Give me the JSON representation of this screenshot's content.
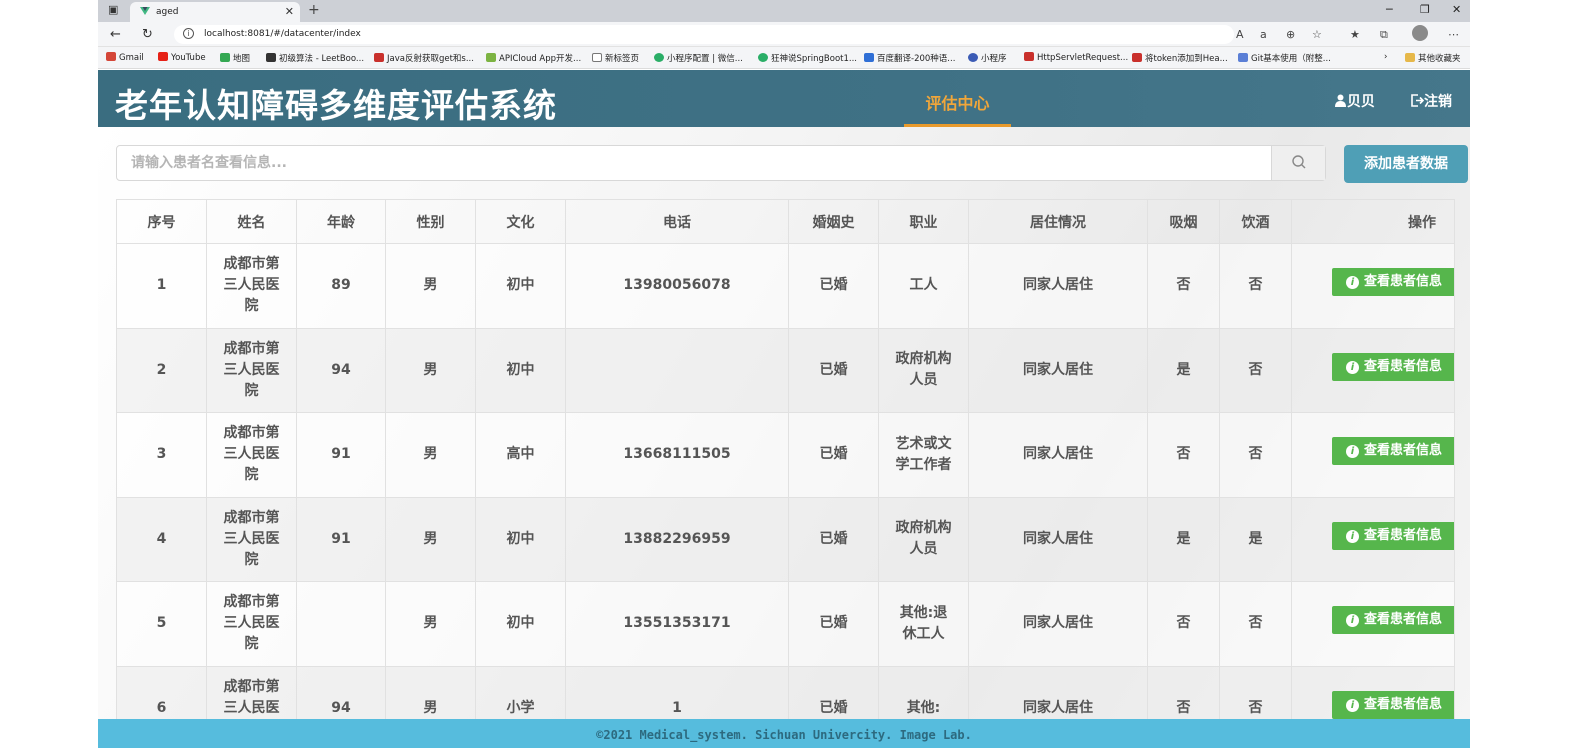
{
  "browser": {
    "tab_title": "aged",
    "url": "localhost:8081/#/datacenter/index",
    "bookmarks": [
      {
        "label": "Gmail",
        "color": "#d44638"
      },
      {
        "label": "YouTube",
        "color": "#e62117"
      },
      {
        "label": "地图",
        "color": "#34a853"
      },
      {
        "label": "初级算法 - LeetBoo...",
        "color": "#333333"
      },
      {
        "label": "Java反射获取get和s...",
        "color": "#c9302c"
      },
      {
        "label": "APICloud App开发...",
        "color": "#7cb342"
      },
      {
        "label": "新标签页",
        "color": "#777777"
      },
      {
        "label": "小程序配置 | 微信...",
        "color": "#2aae67"
      },
      {
        "label": "狂神说SpringBoot1...",
        "color": "#2aae67"
      },
      {
        "label": "百度翻译-200种语...",
        "color": "#2f6fd6"
      },
      {
        "label": "小程序",
        "color": "#3b5bb5"
      },
      {
        "label": "HttpServletRequest...",
        "color": "#c9302c"
      },
      {
        "label": "将token添加到Hea...",
        "color": "#c9302c"
      },
      {
        "label": "Git基本使用（附整...",
        "color": "#5b7fd6"
      },
      {
        "label": "其他收藏夹",
        "color": "#e6b84a"
      }
    ]
  },
  "header": {
    "title": "老年认知障碍多维度评估系统",
    "nav_center": "评估中心",
    "nav_home": "贝贝",
    "nav_logout": "注销"
  },
  "search": {
    "placeholder": "请输入患者名查看信息...",
    "add_button": "添加患者数据"
  },
  "table": {
    "headers": [
      "序号",
      "姓名",
      "年龄",
      "性别",
      "文化",
      "电话",
      "婚姻史",
      "职业",
      "居住情况",
      "吸烟",
      "饮酒",
      "操作"
    ],
    "view_label": "查看患者信息",
    "rows": [
      {
        "id": "1",
        "name": "成都市第三人民医院",
        "age": "89",
        "sex": "男",
        "edu": "初中",
        "phone": "13980056078",
        "marriage": "已婚",
        "job": "工人",
        "living": "同家人居住",
        "smoke": "否",
        "drink": "否"
      },
      {
        "id": "2",
        "name": "成都市第三人民医院",
        "age": "94",
        "sex": "男",
        "edu": "初中",
        "phone": "",
        "marriage": "已婚",
        "job": "政府机构人员",
        "living": "同家人居住",
        "smoke": "是",
        "drink": "否"
      },
      {
        "id": "3",
        "name": "成都市第三人民医院",
        "age": "91",
        "sex": "男",
        "edu": "高中",
        "phone": "13668111505",
        "marriage": "已婚",
        "job": "艺术或文学工作者",
        "living": "同家人居住",
        "smoke": "否",
        "drink": "否"
      },
      {
        "id": "4",
        "name": "成都市第三人民医院",
        "age": "91",
        "sex": "男",
        "edu": "初中",
        "phone": "13882296959",
        "marriage": "已婚",
        "job": "政府机构人员",
        "living": "同家人居住",
        "smoke": "是",
        "drink": "是"
      },
      {
        "id": "5",
        "name": "成都市第三人民医院",
        "age": "",
        "sex": "男",
        "edu": "初中",
        "phone": "13551353171",
        "marriage": "已婚",
        "job": "其他:退休工人",
        "living": "同家人居住",
        "smoke": "否",
        "drink": "否"
      },
      {
        "id": "6",
        "name": "成都市第三人民医院",
        "age": "94",
        "sex": "男",
        "edu": "小学",
        "phone": "1",
        "marriage": "已婚",
        "job": "其他:",
        "living": "同家人居住",
        "smoke": "否",
        "drink": "否"
      }
    ]
  },
  "footer": {
    "text": "©2021 Medical_system. Sichuan Univercity. Image Lab."
  },
  "colors": {
    "header_bg": "#3f7185",
    "nav_active": "#f0a63a",
    "add_button": "#4f9fb6",
    "view_button": "#56b64c",
    "footer_bg": "#56bcdd"
  }
}
